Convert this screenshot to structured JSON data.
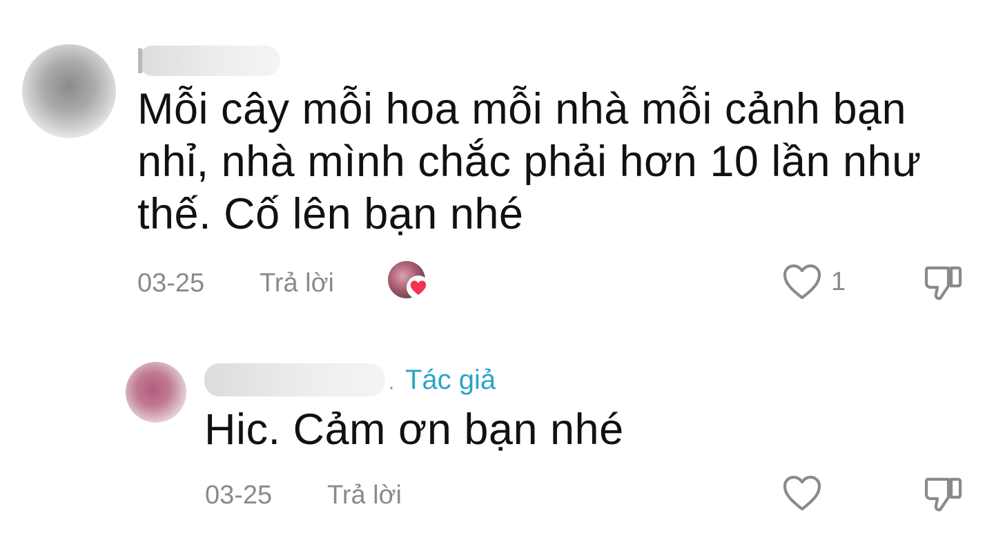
{
  "comments": [
    {
      "text": "Mỗi cây mỗi hoa mỗi nhà mỗi cảnh bạn nhỉ, nhà mình chắc phải hơn 10 lần như thế. Cố lên bạn nhé",
      "date": "03-25",
      "reply_label": "Trả lời",
      "like_count": "1",
      "liked_by_author": true
    },
    {
      "author_badge": "Tác giả",
      "separator": "·",
      "text": "Hic. Cảm ơn bạn nhé",
      "date": "03-25",
      "reply_label": "Trả lời"
    }
  ],
  "icons": {
    "like": "heart-outline-icon",
    "dislike": "thumbs-down-icon",
    "author_liked": "heart-filled-icon"
  },
  "colors": {
    "author_badge": "#2aa4c6",
    "heart_badge": "#f5334f",
    "meta_text": "#8a8a8a"
  }
}
